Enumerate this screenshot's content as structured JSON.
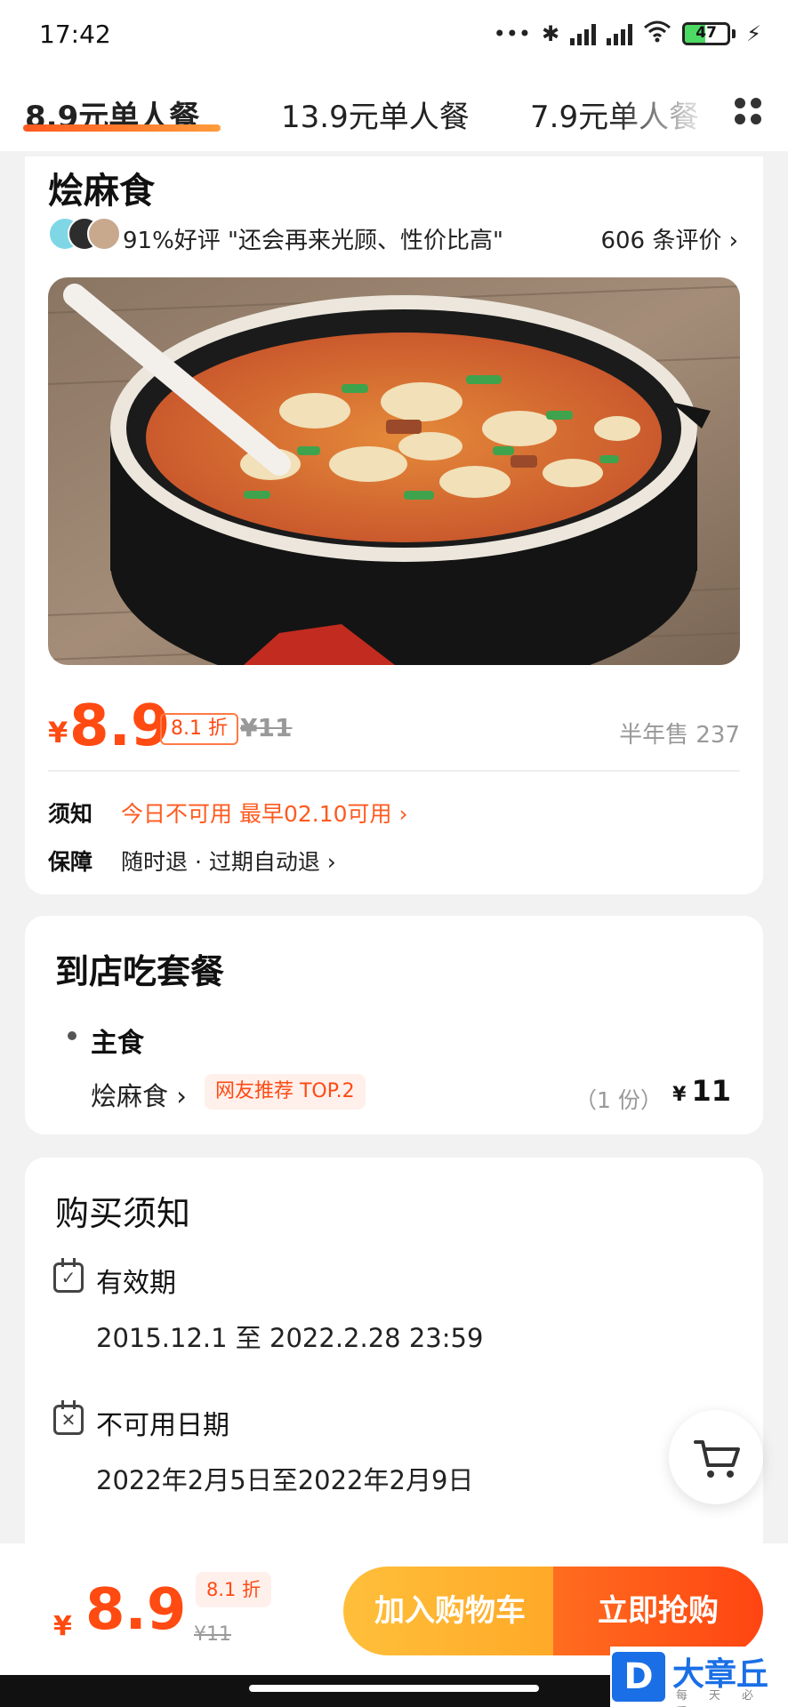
{
  "status_bar": {
    "time": "17:42",
    "battery": "47",
    "battery_level": 0.47
  },
  "tabs": [
    {
      "label": "8.9元单人餐"
    },
    {
      "label": "13.9元单人餐"
    },
    {
      "label": "7.9元单人餐"
    }
  ],
  "product": {
    "title": "烩麻食",
    "rating_text": "91%好评 \"还会再来光顾、性价比高\"",
    "reviews_label": "606 条评价 ›"
  },
  "price": {
    "currency": "¥",
    "value": "8.9",
    "discount": "8.1 折",
    "original": "¥11",
    "sold": "半年售 237"
  },
  "notice": {
    "label": "须知",
    "value": "今日不可用 最早02.10可用 ›"
  },
  "guarantee": {
    "label": "保障",
    "value": "随时退 · 过期自动退 ›"
  },
  "set_meal": {
    "title": "到店吃套餐",
    "category": "主食",
    "item_name": "烩麻食 ›",
    "tag": "网友推荐 TOP.2",
    "portion": "（1 份）",
    "currency": "¥",
    "price": "11"
  },
  "purchase_notes": {
    "title": "购买须知",
    "validity_label": "有效期",
    "validity_value": "2015.12.1 至 2022.2.28 23:59",
    "unavailable_label": "不可用日期",
    "unavailable_value": "2022年2月5日至2022年2月9日"
  },
  "bottom_bar": {
    "currency": "¥",
    "price": "8.9",
    "discount": "8.1 折",
    "original": "¥11",
    "add_cart": "加入购物车",
    "buy_now": "立即抢购"
  },
  "watermark": {
    "logo": "D",
    "name": "大章丘",
    "slogan": "每天必看"
  },
  "colors": {
    "accent": "#ff4a12",
    "cart_button": "#ffb030",
    "tab_underline": "#ff5a1f"
  }
}
